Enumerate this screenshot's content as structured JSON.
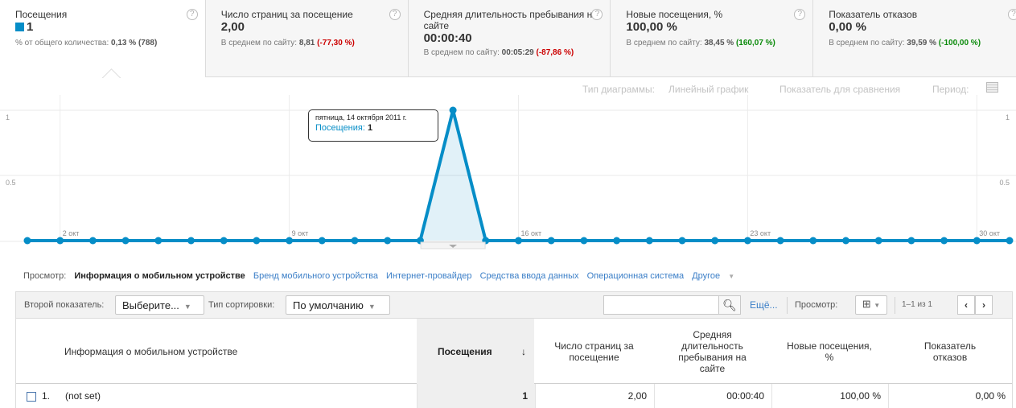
{
  "scorecards": [
    {
      "title": "Посещения",
      "value": "1",
      "sub_prefix": "% от общего количества:",
      "sub_value": "0,13 % (788)",
      "sub_delta": ""
    },
    {
      "title": "Число страниц за посещение",
      "value": "2,00",
      "sub_prefix": "В среднем по сайту:",
      "sub_value": "8,81",
      "sub_delta": "(-77,30 %)"
    },
    {
      "title": "Средняя длительность пребывания на сайте",
      "value": "00:00:40",
      "sub_prefix": "В среднем по сайту:",
      "sub_value": "00:05:29",
      "sub_delta": "(-87,86 %)"
    },
    {
      "title": "Новые посещения, %",
      "value": "100,00 %",
      "sub_prefix": "В среднем по сайту:",
      "sub_value": "38,45 %",
      "sub_delta": "(160,07 %)"
    },
    {
      "title": "Показатель отказов",
      "value": "0,00 %",
      "sub_prefix": "В среднем по сайту:",
      "sub_value": "39,59 %",
      "sub_delta": "(-100,00 %)"
    }
  ],
  "help_glyph": "?",
  "chart_controls": {
    "type_label": "Тип диаграммы:",
    "type_value": "Линейный график",
    "compare_label": "Показатель для сравнения",
    "period_label": "Период:"
  },
  "chart_data": {
    "type": "area",
    "series": [
      {
        "name": "Посещения",
        "values": [
          0,
          0,
          0,
          0,
          0,
          0,
          0,
          0,
          0,
          0,
          0,
          0,
          0,
          1,
          0,
          0,
          0,
          0,
          0,
          0,
          0,
          0,
          0,
          0,
          0,
          0,
          0,
          0,
          0,
          0,
          0
        ]
      }
    ],
    "x": [
      "1 окт",
      "2 окт",
      "3 окт",
      "4 окт",
      "5 окт",
      "6 окт",
      "7 окт",
      "8 окт",
      "9 окт",
      "10 окт",
      "11 окт",
      "12 окт",
      "13 окт",
      "14 окт",
      "15 окт",
      "16 окт",
      "17 окт",
      "18 окт",
      "19 окт",
      "20 окт",
      "21 окт",
      "22 окт",
      "23 окт",
      "24 окт",
      "25 окт",
      "26 окт",
      "27 окт",
      "28 окт",
      "29 окт",
      "30 окт",
      "31 окт"
    ],
    "x_tick_labels": [
      "2 окт",
      "9 окт",
      "16 окт",
      "23 окт",
      "30 окт"
    ],
    "y_tick_labels": [
      "0.5",
      "1"
    ],
    "ylim": [
      0,
      1
    ],
    "color": "#058dc7",
    "tooltip": {
      "date": "пятница, 14 октября 2011 г.",
      "metric": "Посещения:",
      "value": "1"
    }
  },
  "views": {
    "label": "Просмотр:",
    "active": "Информация о мобильном устройстве",
    "links": [
      "Бренд мобильного устройства",
      "Интернет-провайдер",
      "Средства ввода данных",
      "Операционная система"
    ],
    "other": "Другое"
  },
  "toolbar": {
    "secondary_label": "Второй показатель:",
    "secondary_value": "Выберите...",
    "sort_label": "Тип сортировки:",
    "sort_value": "По умолчанию",
    "search_placeholder": "",
    "more": "Ещё...",
    "view_label": "Просмотр:",
    "pager_text": "1–1 из 1",
    "prev": "‹",
    "next": "›"
  },
  "table": {
    "columns": [
      "Информация о мобильном устройстве",
      "Посещения",
      "Число страниц за посещение",
      "Средняя длительность пребывания на сайте",
      "Новые посещения, %",
      "Показатель отказов"
    ],
    "sort_arrow": "↓",
    "rows": [
      {
        "index": "1.",
        "name": "(not set)",
        "visits": "1",
        "pages": "2,00",
        "duration": "00:00:40",
        "new_visits": "100,00 %",
        "bounce": "0,00 %"
      }
    ]
  }
}
